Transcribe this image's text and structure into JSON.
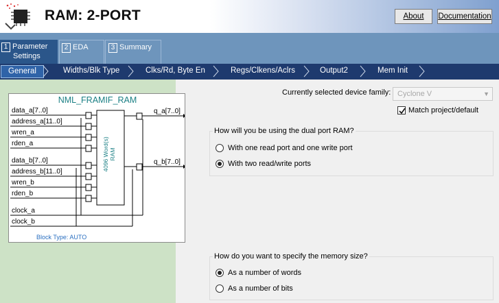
{
  "header": {
    "title": "RAM: 2-PORT",
    "about_label": "About",
    "documentation_label": "Documentation"
  },
  "tabs": [
    {
      "num": "1",
      "label_line1": "Parameter",
      "label_line2": "Settings"
    },
    {
      "num": "2",
      "label_line1": "EDA",
      "label_line2": ""
    },
    {
      "num": "3",
      "label_line1": "Summary",
      "label_line2": ""
    }
  ],
  "subtabs": [
    "General",
    "Widths/Blk Type",
    "Clks/Rd, Byte En",
    "Regs/Clkens/Aclrs",
    "Output2",
    "Mem Init"
  ],
  "diagram": {
    "title": "NML_FRAMIF_RAM",
    "inputs": [
      "data_a[7..0]",
      "address_a[11..0]",
      "wren_a",
      "rden_a",
      "data_b[7..0]",
      "address_b[11..0]",
      "wren_b",
      "rden_b",
      "clock_a",
      "clock_b"
    ],
    "outputs": [
      "q_a[7..0]",
      "q_b[7..0]"
    ],
    "ram_label_1": "4096 Word(s)",
    "ram_label_2": "RAM",
    "block_type": "Block Type: AUTO"
  },
  "device": {
    "label": "Currently selected device family:",
    "value": "Cyclone V",
    "match_label": "Match project/default",
    "match_checked": true
  },
  "usage_group": {
    "title": "How will you be using the dual port RAM?",
    "options": [
      "With one read port and one write port",
      "With two read/write ports"
    ],
    "selected": "With two read/write ports"
  },
  "size_group": {
    "title": "How do you want to specify the memory size?",
    "options": [
      "As a number of words",
      "As a number of bits"
    ],
    "selected": "As a number of words"
  },
  "colors": {
    "tab_bar": "#6e95bc",
    "sub_bar": "#1e3a6e",
    "left_pane": "#cde2c6",
    "diagram_accent": "#1a7f84"
  }
}
